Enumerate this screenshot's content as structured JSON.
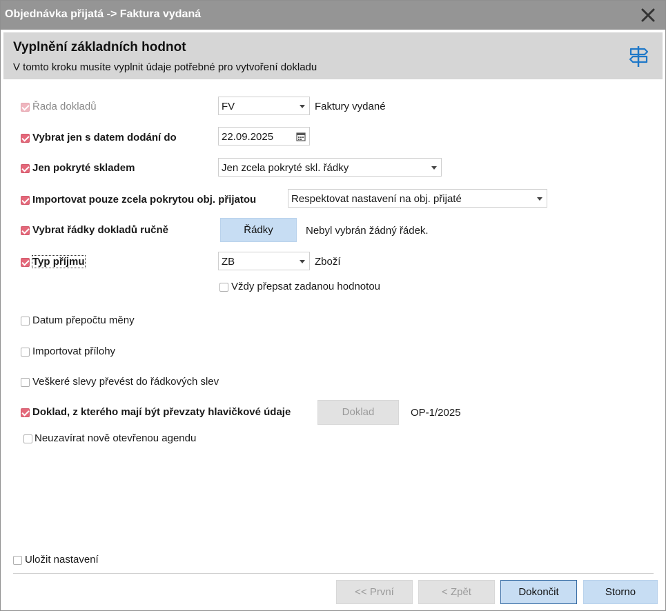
{
  "window": {
    "title": "Objednávka přijatá -> Faktura vydaná"
  },
  "header": {
    "title": "Vyplnění základních hodnot",
    "subtitle": "V tomto kroku musíte vyplnit údaje potřebné pro vytvoření dokladu"
  },
  "colors": {
    "checkbox_checked": "#e4687a",
    "button_blue": "#c7ddf3",
    "header_bg": "#d6d6d6",
    "titlebar_bg": "#959595"
  },
  "fields": {
    "rada": {
      "label": "Řada dokladů",
      "checked": true,
      "disabled": true,
      "value": "FV",
      "note": "Faktury vydané"
    },
    "datum_dodani": {
      "label": "Vybrat jen s datem dodání do",
      "checked": true,
      "value": "22.09.2025"
    },
    "pokryte_skladem": {
      "label": "Jen pokryté skladem",
      "checked": true,
      "value": "Jen zcela pokryté skl. řádky"
    },
    "importovat_pokrytou": {
      "label": "Importovat pouze zcela pokrytou obj. přijatou",
      "checked": true,
      "value": "Respektovat nastavení na obj. přijaté"
    },
    "radky_rucne": {
      "label": "Vybrat řádky dokladů ručně",
      "checked": true,
      "button": "Řádky",
      "note": "Nebyl vybrán žádný řádek."
    },
    "typ_prijmu": {
      "label": "Typ příjmu",
      "checked": true,
      "value": "ZB",
      "note": "Zboží"
    },
    "vzdy_prepsat": {
      "label": "Vždy přepsat zadanou hodnotou",
      "checked": false
    },
    "datum_prepoctu": {
      "label": "Datum přepočtu měny",
      "checked": false
    },
    "importovat_prilohy": {
      "label": "Importovat přílohy",
      "checked": false
    },
    "slevy": {
      "label": "Veškeré slevy převést do řádkových slev",
      "checked": false
    },
    "doklad_hlavicka": {
      "label": "Doklad, z kterého mají být převzaty hlavičkové údaje",
      "checked": true,
      "button": "Doklad",
      "note": "OP-1/2025"
    },
    "neuzavirat": {
      "label": "Neuzavírat nově otevřenou agendu",
      "checked": false
    }
  },
  "footer": {
    "save_settings": {
      "label": "Uložit nastavení",
      "checked": false
    },
    "buttons": {
      "first": "<< První",
      "back": "< Zpět",
      "finish": "Dokončit",
      "cancel": "Storno"
    }
  }
}
